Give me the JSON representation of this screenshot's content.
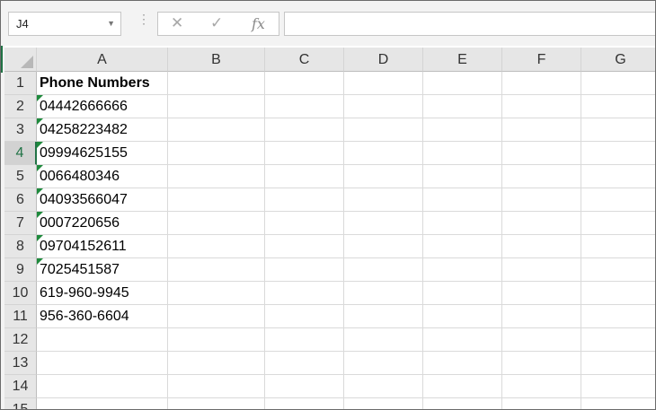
{
  "name_box": {
    "value": "J4",
    "dropdown_icon": "chevron-down-icon"
  },
  "formula_bar": {
    "cancel_icon": "cancel-x-icon",
    "enter_icon": "check-icon",
    "fx_label": "fx",
    "value": ""
  },
  "columns": [
    "A",
    "B",
    "C",
    "D",
    "E",
    "F",
    "G"
  ],
  "rows": [
    {
      "num": "1",
      "a": "Phone Numbers",
      "bold": true,
      "flag": false
    },
    {
      "num": "2",
      "a": "04442666666",
      "flag": true
    },
    {
      "num": "3",
      "a": "04258223482",
      "flag": true
    },
    {
      "num": "4",
      "a": "09994625155",
      "flag": true,
      "selected": true
    },
    {
      "num": "5",
      "a": "0066480346",
      "flag": true
    },
    {
      "num": "6",
      "a": "04093566047",
      "flag": true
    },
    {
      "num": "7",
      "a": "0007220656",
      "flag": true
    },
    {
      "num": "8",
      "a": "09704152611",
      "flag": true
    },
    {
      "num": "9",
      "a": "7025451587",
      "flag": true
    },
    {
      "num": "10",
      "a": "619-960-9945",
      "flag": false
    },
    {
      "num": "11",
      "a": "956-360-6604",
      "flag": false
    },
    {
      "num": "12",
      "a": "",
      "flag": false
    },
    {
      "num": "13",
      "a": "",
      "flag": false
    },
    {
      "num": "14",
      "a": "",
      "flag": false
    },
    {
      "num": "15",
      "a": "",
      "flag": false
    }
  ],
  "colors": {
    "accent": "#217346",
    "error_flag": "#1e8a3c",
    "header_bg": "#e6e6e6"
  }
}
